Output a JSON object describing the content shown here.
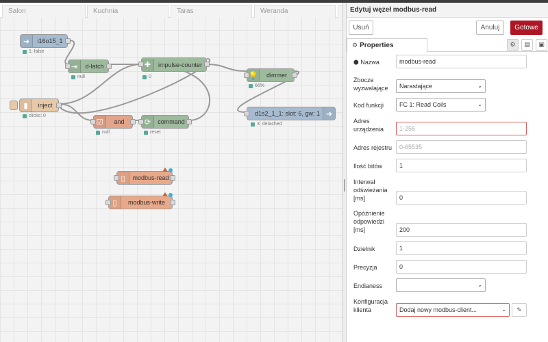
{
  "workspace": {
    "tabs": [
      "Salon",
      "Kuchnia",
      "Taras",
      "Weranda"
    ],
    "nodes": {
      "i16o15": {
        "label": "i16o15_1",
        "status": "1: false"
      },
      "dlatch": {
        "label": "d-latch",
        "status": "null"
      },
      "impulse": {
        "label": "impulse-counter",
        "status": "0"
      },
      "dimmer": {
        "label": "dimmer",
        "status": "66%"
      },
      "inject": {
        "label": "inject",
        "status": "clicks: 0"
      },
      "and": {
        "label": "and",
        "status": "null"
      },
      "command": {
        "label": "command",
        "status": "reset"
      },
      "d1s2": {
        "label": "d1s2_1_1: slot: 6, gw: 1",
        "status": "3: detached"
      },
      "mread": {
        "label": "modbus-read"
      },
      "mwrite": {
        "label": "modbus-write"
      }
    }
  },
  "panel": {
    "title": "Edytuj węzeł modbus-read",
    "delete_label": "Usuń",
    "cancel_label": "Anuluj",
    "done_label": "Gotowe",
    "tab_properties": "Properties",
    "fields": {
      "name_label": "Nazwa",
      "name_value": "modbus-read",
      "trigger_label": "Zbocze wyzwalające",
      "trigger_value": "Narastające",
      "fc_label": "Kod funkcji",
      "fc_value": "FC 1: Read Coils",
      "device_label": "Adres urządzenia",
      "device_placeholder": "1-255",
      "register_label": "Adres rejestru",
      "register_placeholder": "0-65535",
      "bits_label": "Ilość bitów",
      "bits_value": "1",
      "refresh_label": "Interwał odświeżania [ms]",
      "refresh_value": "0",
      "delay_label": "Opóźnienie odpowiedzi [ms]",
      "delay_value": "200",
      "divider_label": "Dzielnik",
      "divider_value": "1",
      "precision_label": "Precyzja",
      "precision_value": "0",
      "endianess_label": "Endianess",
      "endianess_value": "",
      "client_label": "Konfiguracja klienta",
      "client_value": "Dodaj nowy modbus-client..."
    }
  },
  "colors": {
    "done_button": "#ad1625",
    "node_blue": "#a6bbcf",
    "node_green": "#9ebb9e",
    "node_salmon": "#e2a48a",
    "node_orange": "#e8a98a",
    "node_inject": "#e7c8a7"
  }
}
